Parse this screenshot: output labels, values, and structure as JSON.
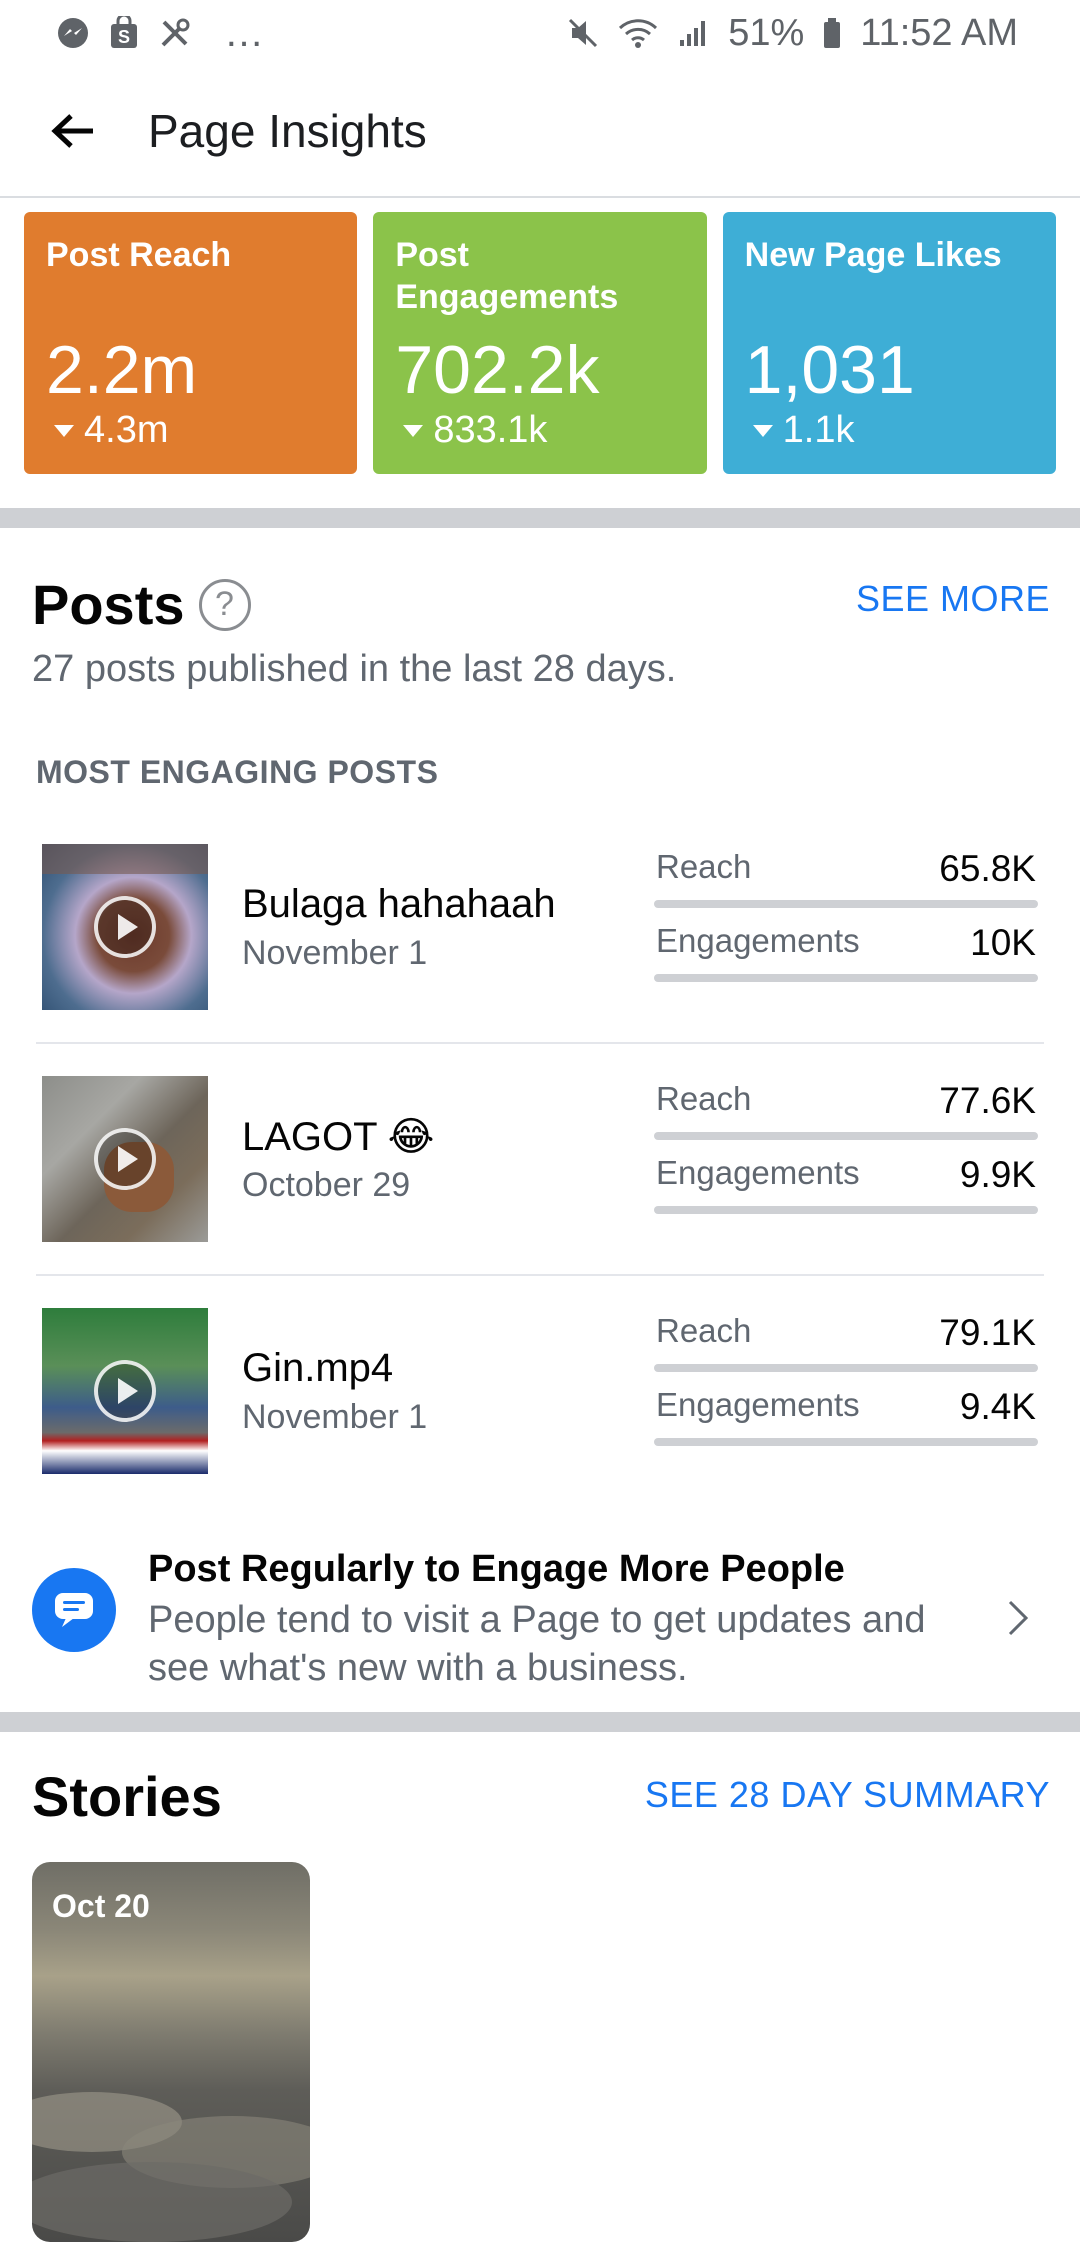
{
  "status_bar": {
    "battery": "51%",
    "time": "11:52 AM",
    "left_icons": [
      "messenger-icon",
      "shop-icon",
      "tools-icon"
    ],
    "more": "…",
    "right_icons": [
      "mute-icon",
      "wifi-icon",
      "signal-icon",
      "battery-icon"
    ]
  },
  "header": {
    "title": "Page Insights"
  },
  "metrics": [
    {
      "label": "Post Reach",
      "value": "2.2m",
      "delta": "4.3m",
      "color": "#e07c2e"
    },
    {
      "label": "Post Engagements",
      "value": "702.2k",
      "delta": "833.1k",
      "color": "#8bc34a"
    },
    {
      "label": "New Page Likes",
      "value": "1,031",
      "delta": "1.1k",
      "color": "#3eaed6"
    }
  ],
  "posts": {
    "title": "Posts",
    "help": "?",
    "see_more": "SEE MORE",
    "subtitle": "27 posts published in the last 28 days.",
    "most_engaging_heading": "MOST ENGAGING POSTS",
    "items": [
      {
        "name": "Bulaga hahahaah",
        "emoji": "",
        "date": "November 1",
        "reach_label": "Reach",
        "reach": "65.8K",
        "eng_label": "Engagements",
        "engagements": "10K"
      },
      {
        "name": "LAGOT",
        "emoji": "😂",
        "date": "October 29",
        "reach_label": "Reach",
        "reach": "77.6K",
        "eng_label": "Engagements",
        "engagements": "9.9K"
      },
      {
        "name": "Gin.mp4",
        "emoji": "",
        "date": "November 1",
        "reach_label": "Reach",
        "reach": "79.1K",
        "eng_label": "Engagements",
        "engagements": "9.4K"
      }
    ],
    "tip": {
      "title": "Post Regularly to Engage More People",
      "body": "People tend to visit a Page to get updates and see what's new with a business."
    }
  },
  "stories": {
    "title": "Stories",
    "see_summary": "SEE 28 DAY SUMMARY",
    "cards": [
      {
        "date": "Oct 20"
      }
    ]
  },
  "colors": {
    "accent_link": "#1877f2",
    "divider": "#ced0d4"
  }
}
